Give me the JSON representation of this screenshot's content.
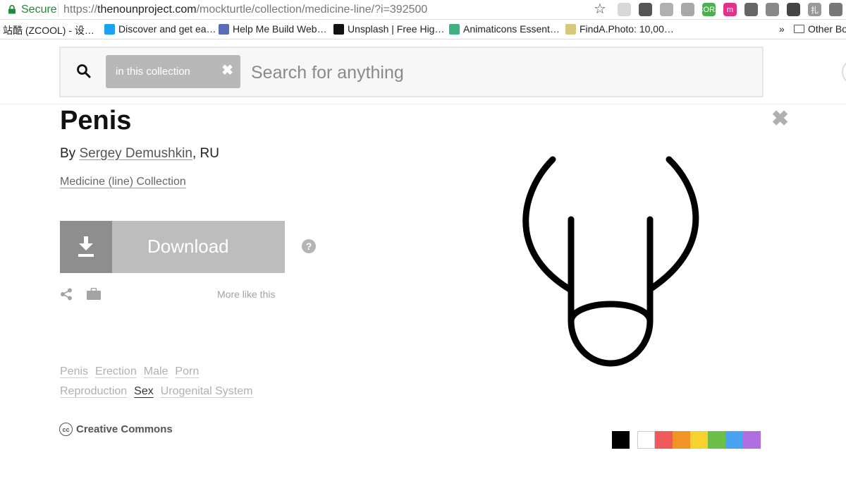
{
  "browser": {
    "secure_label": "Secure",
    "url_scheme": "https://",
    "url_host": "thenounproject.com",
    "url_path": "/mockturtle/collection/medicine-line/?i=392500",
    "extensions": [
      {
        "name": "hedgehog",
        "color": "#d8d8d8"
      },
      {
        "name": "pocket",
        "color": "#555555"
      },
      {
        "name": "shield",
        "color": "#b0b0b0"
      },
      {
        "name": "drive",
        "color": "#a8a8a8"
      },
      {
        "name": "cors",
        "color": "#4caf50",
        "text": "CORS"
      },
      {
        "name": "m",
        "color": "#e0338a",
        "text": "m"
      },
      {
        "name": "square",
        "color": "#666666"
      },
      {
        "name": "camera",
        "color": "#888888"
      },
      {
        "name": "hex",
        "color": "#444444"
      },
      {
        "name": "kanji",
        "color": "#999999",
        "text": "扎"
      },
      {
        "name": "grid",
        "color": "#777777"
      }
    ],
    "bookmarks": [
      {
        "label": "站酷 (ZCOOL) - 设…",
        "icon": "none",
        "color": "#ffffff"
      },
      {
        "label": "Discover and get ea…",
        "icon": "lines-icon",
        "color": "#1da1f2"
      },
      {
        "label": "Help Me Build Web…",
        "icon": "diamond-icon",
        "color": "#5a6bb8"
      },
      {
        "label": "Unsplash | Free Hig…",
        "icon": "camera-icon",
        "color": "#111111"
      },
      {
        "label": "Animaticons Essent…",
        "icon": "a-icon",
        "color": "#3fb27f"
      },
      {
        "label": "FindA.Photo: 10,00…",
        "icon": "photo-icon",
        "color": "#d9c87a"
      }
    ],
    "overflow": "»",
    "other_bookmarks": "Other Bo"
  },
  "search": {
    "scope_label": "in this collection",
    "scope_close": "✖",
    "placeholder": "Search for anything"
  },
  "icon": {
    "title": "Penis",
    "by_prefix": "By ",
    "author": "Sergey Demushkin",
    "author_suffix": ", RU",
    "collection": "Medicine (line) Collection",
    "download_label": "Download",
    "help": "?",
    "more_like_this": "More like this",
    "close": "✖",
    "license": "Creative Commons",
    "cc_badge": "cc"
  },
  "tags": [
    [
      {
        "label": "Penis",
        "active": false
      },
      {
        "label": "Erection",
        "active": false
      },
      {
        "label": "Male",
        "active": false
      },
      {
        "label": "Porn",
        "active": false
      }
    ],
    [
      {
        "label": "Reproduction",
        "active": false
      },
      {
        "label": "Sex",
        "active": true
      },
      {
        "label": "Urogenital System",
        "active": false
      }
    ]
  ],
  "colors": {
    "selected": "#000000",
    "palette": [
      "#ffffff",
      "#ef5b5b",
      "#f39325",
      "#f7d12e",
      "#6cc04a",
      "#4aa3f0",
      "#b06ee0"
    ]
  }
}
